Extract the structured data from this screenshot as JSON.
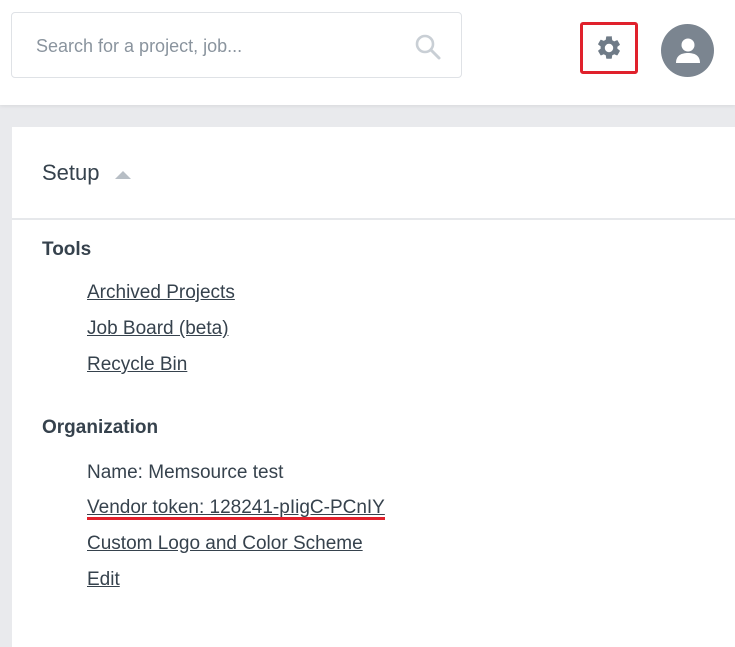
{
  "search": {
    "placeholder": "Search for a project, job..."
  },
  "icons": {
    "search": "search-icon",
    "settings": "gear-icon",
    "user": "user-icon",
    "caret": "caret-up-icon"
  },
  "colors": {
    "highlight": "#e0212c",
    "text": "#36424d",
    "avatar_bg": "#7b8590"
  },
  "setup": {
    "title": "Setup",
    "tools": {
      "heading": "Tools",
      "items": [
        {
          "label": "Archived Projects"
        },
        {
          "label": "Job Board (beta)"
        },
        {
          "label": "Recycle Bin"
        }
      ]
    },
    "organization": {
      "heading": "Organization",
      "name_label": "Name: Memsource test",
      "items": [
        {
          "label": "Vendor token: 128241-pIigC-PCnIY"
        },
        {
          "label": "Custom Logo and Color Scheme"
        },
        {
          "label": "Edit"
        }
      ]
    }
  }
}
